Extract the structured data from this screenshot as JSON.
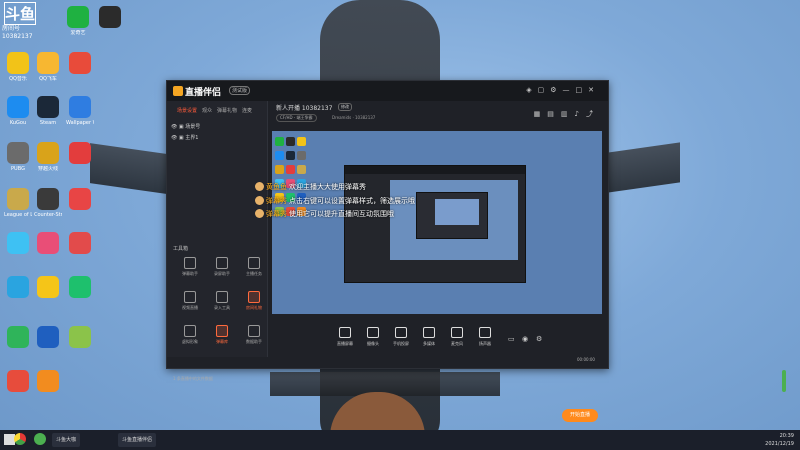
{
  "desktop": {
    "room_badge": {
      "logo": "斗鱼",
      "label": "房间号",
      "room_id": "10382137"
    },
    "icons": [
      {
        "label": "爱奇艺",
        "color": "#1fb141"
      },
      {
        "label": "",
        "color": "#2b2b2b"
      },
      {
        "label": "QQ音乐",
        "color": "#f2c318"
      },
      {
        "label": "QQ飞车",
        "color": "#f7b731"
      },
      {
        "label": "",
        "color": "#e84b3a"
      },
      {
        "label": "KuGou",
        "color": "#1d8cf0"
      },
      {
        "label": "Steam",
        "color": "#1b2838"
      },
      {
        "label": "Wallpaper Workshop",
        "color": "#2f7de1"
      },
      {
        "label": "PUBG",
        "color": "#6b6b6b"
      },
      {
        "label": "穿越火线",
        "color": "#d9a31a"
      },
      {
        "label": "",
        "color": "#e33d3d"
      },
      {
        "label": "League of Legends",
        "color": "#c9a94b"
      },
      {
        "label": "Counter-Strike Global Off",
        "color": "#3a3a3a"
      },
      {
        "label": "",
        "color": "#e84545"
      },
      {
        "label": "",
        "color": "#3ec1f3"
      },
      {
        "label": "",
        "color": "#e94e77"
      },
      {
        "label": "",
        "color": "#e24b4b"
      },
      {
        "label": "",
        "color": "#2aa4e0"
      },
      {
        "label": "",
        "color": "#f5c518"
      },
      {
        "label": "",
        "color": "#1ec06d"
      },
      {
        "label": "",
        "color": "#2fb45a"
      },
      {
        "label": "",
        "color": "#1f5fbf"
      },
      {
        "label": "",
        "color": "#8bc34a"
      },
      {
        "label": "",
        "color": "#e74c3c"
      },
      {
        "label": "",
        "color": "#f28c1f"
      }
    ]
  },
  "app": {
    "title": "直播伴侣",
    "badge": "测试版",
    "left_tabs": [
      "场景设置",
      "观众",
      "弹幕礼物",
      "连麦"
    ],
    "scenes": [
      "场景号",
      "主界1"
    ],
    "tools_heading": "工具箱",
    "tools": [
      {
        "label": "弹幕助手",
        "hot": false
      },
      {
        "label": "录屏助手",
        "hot": false
      },
      {
        "label": "主播任务",
        "hot": false
      },
      {
        "label": "视频直播",
        "hot": false
      },
      {
        "label": "录入工具",
        "hot": false
      },
      {
        "label": "房间礼物",
        "hot": true
      },
      {
        "label": "虚拟形象",
        "hot": false
      },
      {
        "label": "弹幕库",
        "hot": true
      },
      {
        "label": "数据助手",
        "hot": false
      }
    ],
    "status_left": "1 条直播中的文件数据",
    "room_title": "新人开播 10382137",
    "edit": "修改",
    "category": "CF/HD - 端王争霸",
    "subline": "Dreamids · 10382137",
    "danmu": [
      {
        "name": "黄鱼鱼",
        "text": "欢迎主播大大使用弹幕秀"
      },
      {
        "name": "弹幕秀",
        "text": "点击右键可以设置弹幕样式，筛选展示哦"
      },
      {
        "name": "弹幕秀",
        "text": "使用它可以提升直播间互动氛围哦"
      }
    ],
    "controls": [
      "直播屏幕",
      "摄像头",
      "手机投屏",
      "多媒体",
      "麦克风",
      "扬声器"
    ],
    "go_live": "开始直播",
    "timer": "00:00:00"
  },
  "taskbar": {
    "buttons": [
      "斗鱼大咖",
      "斗鱼直播伴侣"
    ],
    "time": "20:39",
    "date": "2021/12/19"
  }
}
